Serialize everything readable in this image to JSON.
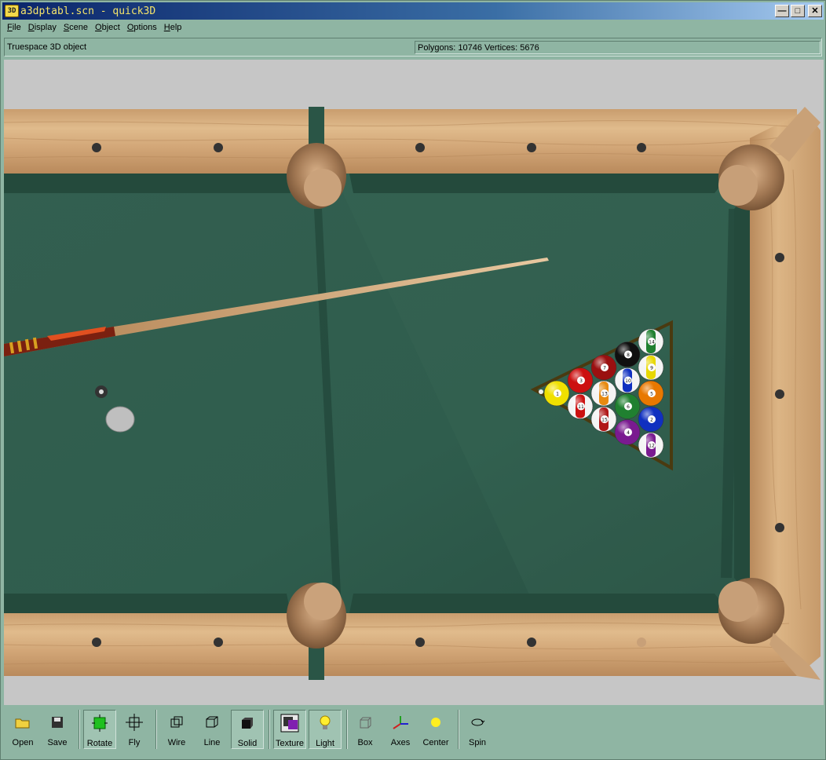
{
  "window": {
    "icon_label": "3D",
    "title": "a3dptabl.scn - quick3D"
  },
  "menu": [
    "File",
    "Display",
    "Scene",
    "Object",
    "Options",
    "Help"
  ],
  "status": {
    "object_type": "Truespace 3D object",
    "stats": "Polygons: 10746  Vertices: 5676"
  },
  "toolbar": {
    "open": "Open",
    "save": "Save",
    "rotate": "Rotate",
    "fly": "Fly",
    "wire": "Wire",
    "line": "Line",
    "solid": "Solid",
    "texture": "Texture",
    "light": "Light",
    "box": "Box",
    "axes": "Axes",
    "center": "Center",
    "spin": "Spin"
  },
  "scene": {
    "felt_color": "#2f5f4e",
    "wood_color": "#d4aa7c",
    "balls": [
      {
        "color": "#f0e000",
        "stripe": false,
        "n": "1"
      },
      {
        "color": "#cc1010",
        "stripe": false,
        "n": "3"
      },
      {
        "color": "#cc1010",
        "stripe": true,
        "n": "11"
      },
      {
        "color": "#9a1010",
        "stripe": false,
        "n": "7"
      },
      {
        "color": "#e88a10",
        "stripe": true,
        "n": "13"
      },
      {
        "color": "#b01818",
        "stripe": true,
        "n": "15"
      },
      {
        "color": "#101010",
        "stripe": false,
        "n": "8"
      },
      {
        "color": "#1030c0",
        "stripe": true,
        "n": "10"
      },
      {
        "color": "#208030",
        "stripe": false,
        "n": "6"
      },
      {
        "color": "#7a1a90",
        "stripe": false,
        "n": "4"
      },
      {
        "color": "#208030",
        "stripe": true,
        "n": "14"
      },
      {
        "color": "#e8d800",
        "stripe": true,
        "n": "9"
      },
      {
        "color": "#e87800",
        "stripe": false,
        "n": "5"
      },
      {
        "color": "#1030c0",
        "stripe": false,
        "n": "2"
      },
      {
        "color": "#7a1a90",
        "stripe": true,
        "n": "12"
      }
    ]
  }
}
